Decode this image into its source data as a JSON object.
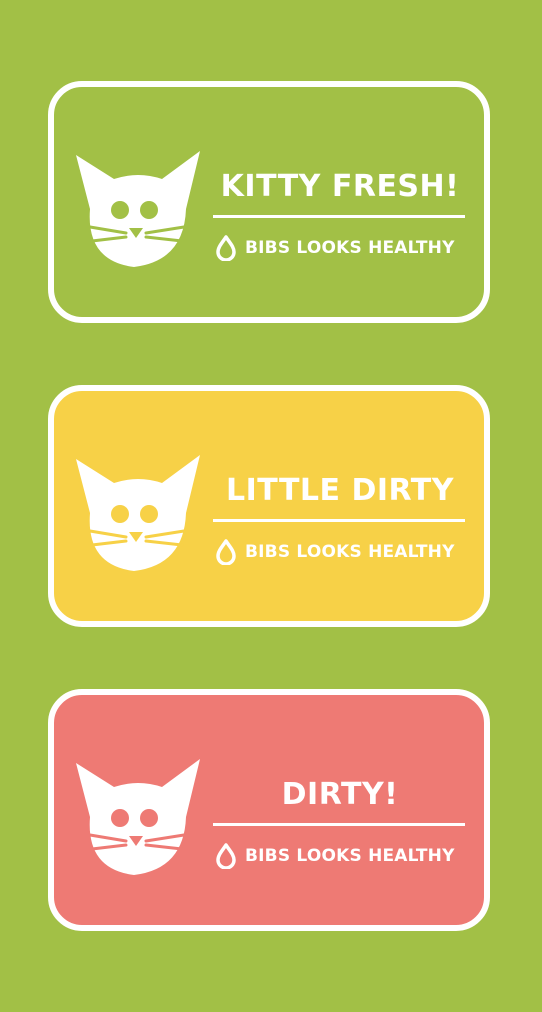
{
  "colors": {
    "background": "#a2c046",
    "border": "#ffffff",
    "text": "#ffffff"
  },
  "icons": {
    "cat": "cat-face-icon",
    "status": "water-drop-icon"
  },
  "cards": [
    {
      "title": "KITTY FRESH!",
      "status": "BIBS LOOKS HEALTHY",
      "fill": "#a2c046"
    },
    {
      "title": "LITTLE DIRTY",
      "status": "BIBS LOOKS HEALTHY",
      "fill": "#f7d147"
    },
    {
      "title": "DIRTY!",
      "status": "BIBS LOOKS HEALTHY",
      "fill": "#ee7a74"
    }
  ]
}
